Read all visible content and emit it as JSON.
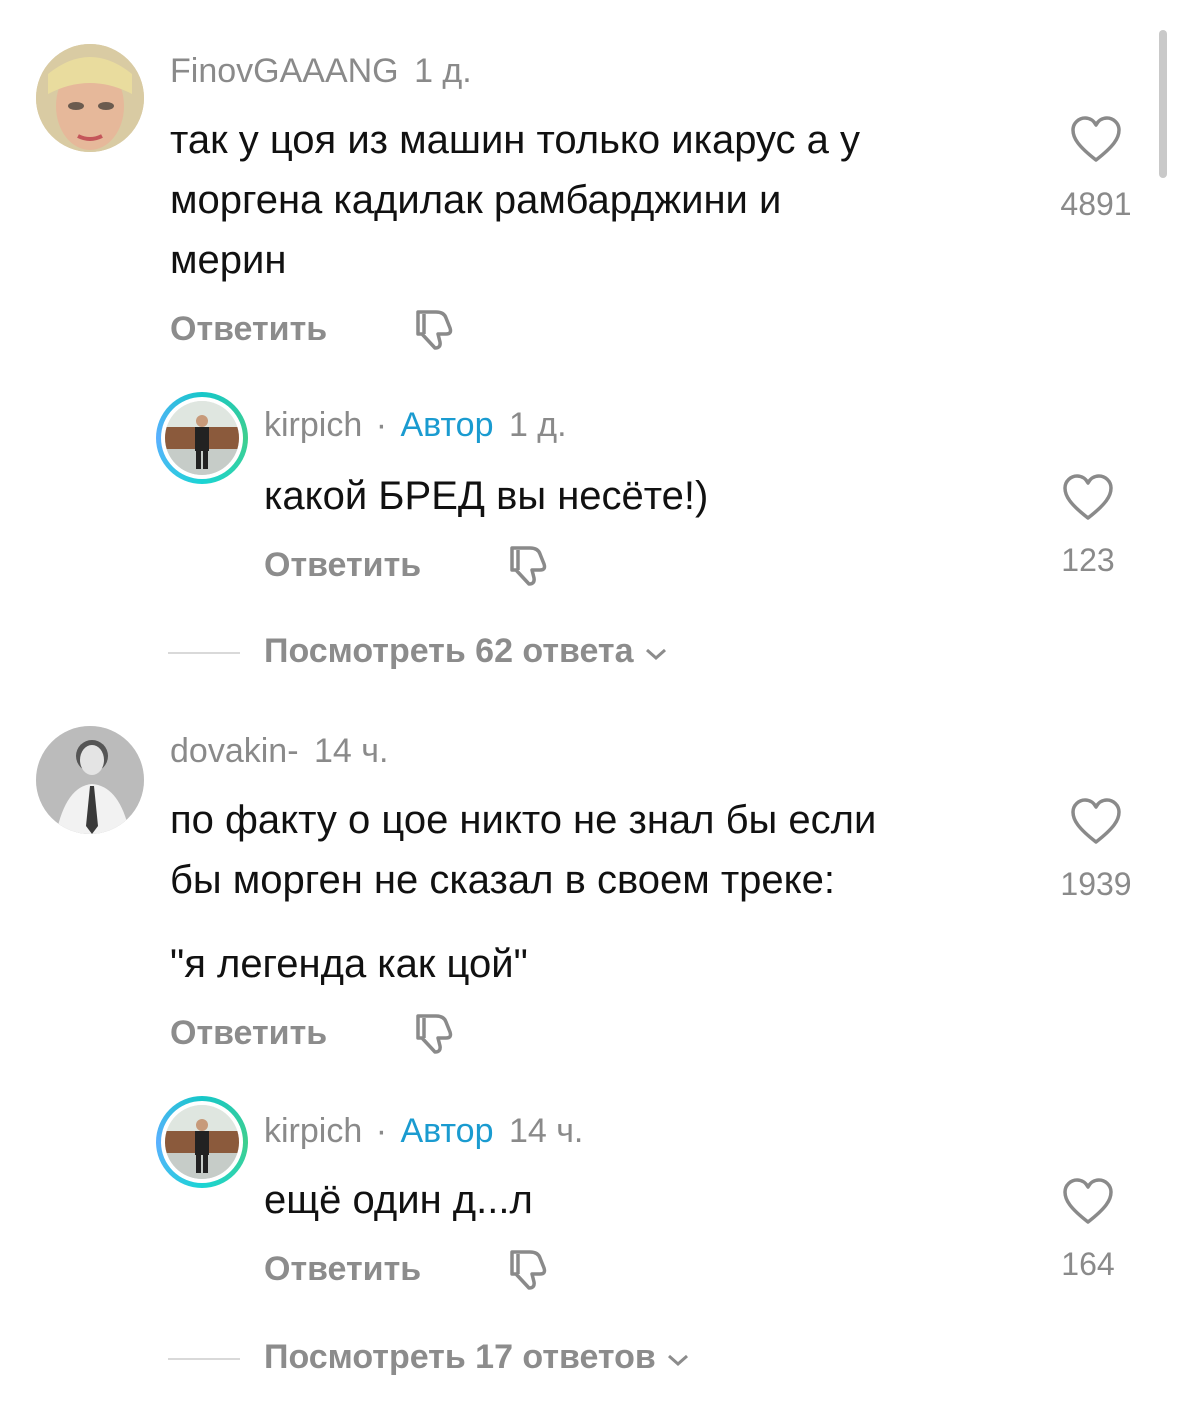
{
  "comments": [
    {
      "user": "FinovGAAANG",
      "time": "1 д.",
      "text_lines": [
        "так у цоя из машин только икарус а у",
        "моргена кадилак рамбарджини и",
        "мерин"
      ],
      "reply_label": "Ответить",
      "likes": "4891",
      "reply": {
        "user": "kirpich",
        "separator": "·",
        "badge": "Автор",
        "time": "1 д.",
        "text": "какой БРЕД вы несёте!)",
        "reply_label": "Ответить",
        "likes": "123"
      },
      "view_more": "Посмотреть 62 ответа"
    },
    {
      "user": "dovakin-",
      "time": "14 ч.",
      "text_lines": [
        "по факту о цое никто не знал бы если",
        "бы морген не сказал в своем треке:"
      ],
      "text_extra": "\"я легенда как цой\"",
      "reply_label": "Ответить",
      "likes": "1939",
      "reply": {
        "user": "kirpich",
        "separator": "·",
        "badge": "Автор",
        "time": "14 ч.",
        "text": "ещё один д...л",
        "reply_label": "Ответить",
        "likes": "164"
      },
      "view_more": "Посмотреть 17 ответов"
    }
  ],
  "colors": {
    "author_badge": "#1a9bd0",
    "muted": "#8a8a8a",
    "ring": "#16c7c9"
  },
  "icons": [
    "heart-icon",
    "dislike-icon",
    "chevron-down-icon"
  ]
}
